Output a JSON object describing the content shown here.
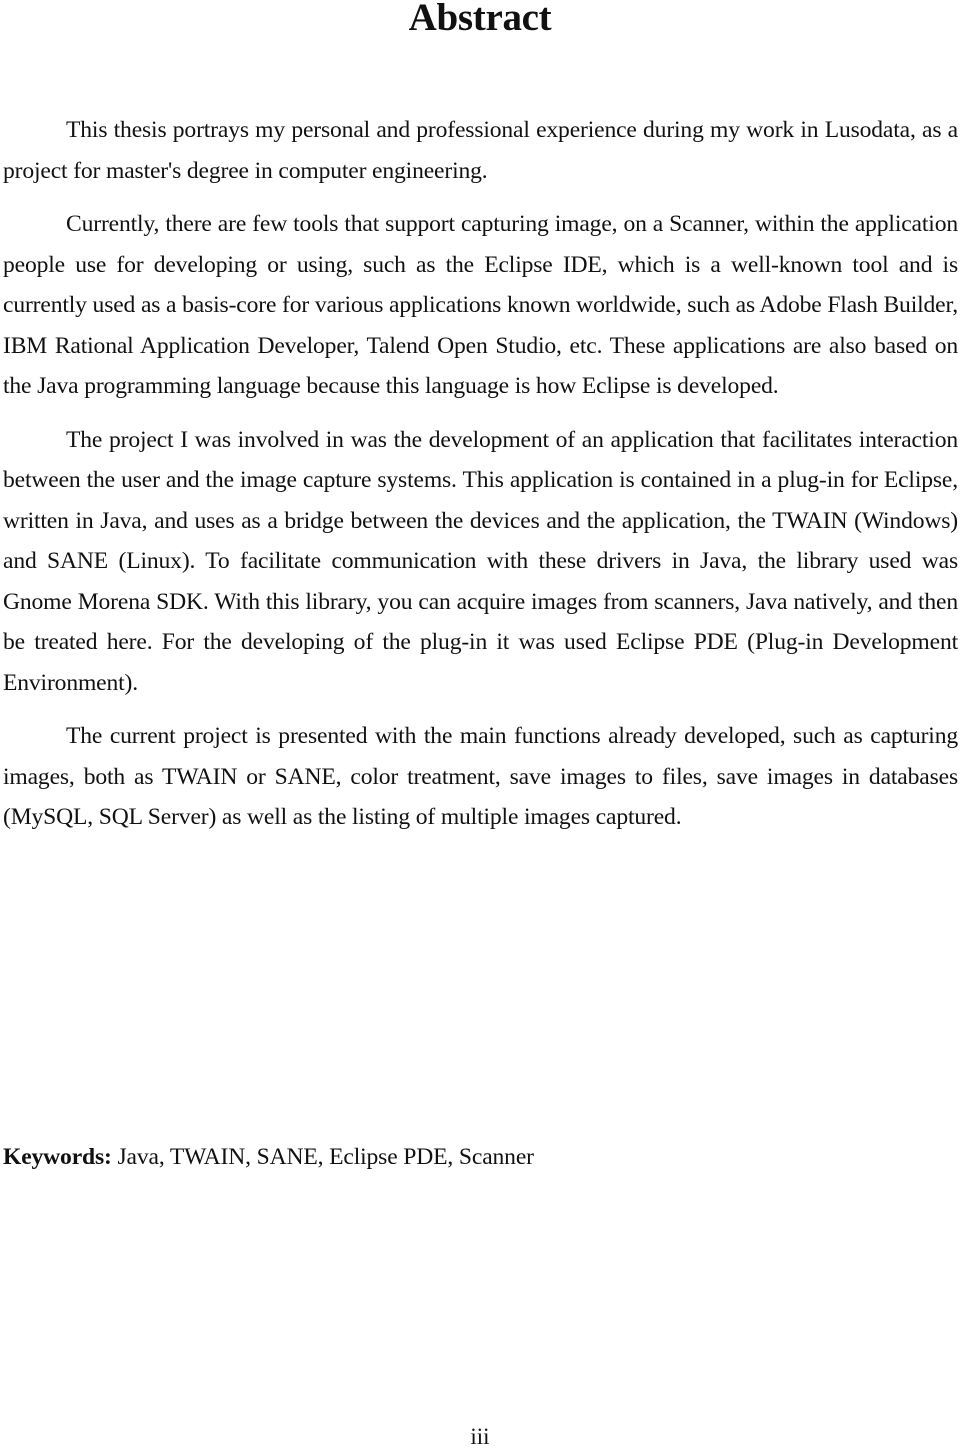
{
  "document": {
    "title": "Abstract",
    "paragraphs": [
      "This thesis portrays my personal and professional experience during my work in Lusodata, as a project for master's degree in computer engineering.",
      "Currently, there are few tools that support capturing image, on a Scanner, within the application people use for developing or using, such as the Eclipse IDE, which is a well-known tool and is currently used as a basis-core for various applications known worldwide, such as Adobe Flash Builder, IBM Rational Application Developer, Talend Open Studio, etc. These applications are also based on the Java programming language because this language is how Eclipse is developed.",
      "The project I was involved in was the development of an application that facilitates interaction between the user and the image capture systems. This application is contained in a plug-in for Eclipse, written in Java, and uses as a bridge between the devices and the application, the TWAIN (Windows) and SANE (Linux). To facilitate communication with these drivers in Java, the library used was Gnome Morena SDK. With this library, you can acquire images from scanners, Java natively, and then be treated here. For the developing of the plug-in it was used Eclipse PDE (Plug-in Development Environment).",
      "The current project is presented with the main functions already developed, such as capturing images, both as TWAIN or SANE, color treatment, save images to files, save images in databases (MySQL, SQL Server) as well as the listing of multiple images captured."
    ],
    "keywords": {
      "label": "Keywords:",
      "value": " Java, TWAIN, SANE, Eclipse PDE, Scanner"
    },
    "page_number": "iii"
  }
}
